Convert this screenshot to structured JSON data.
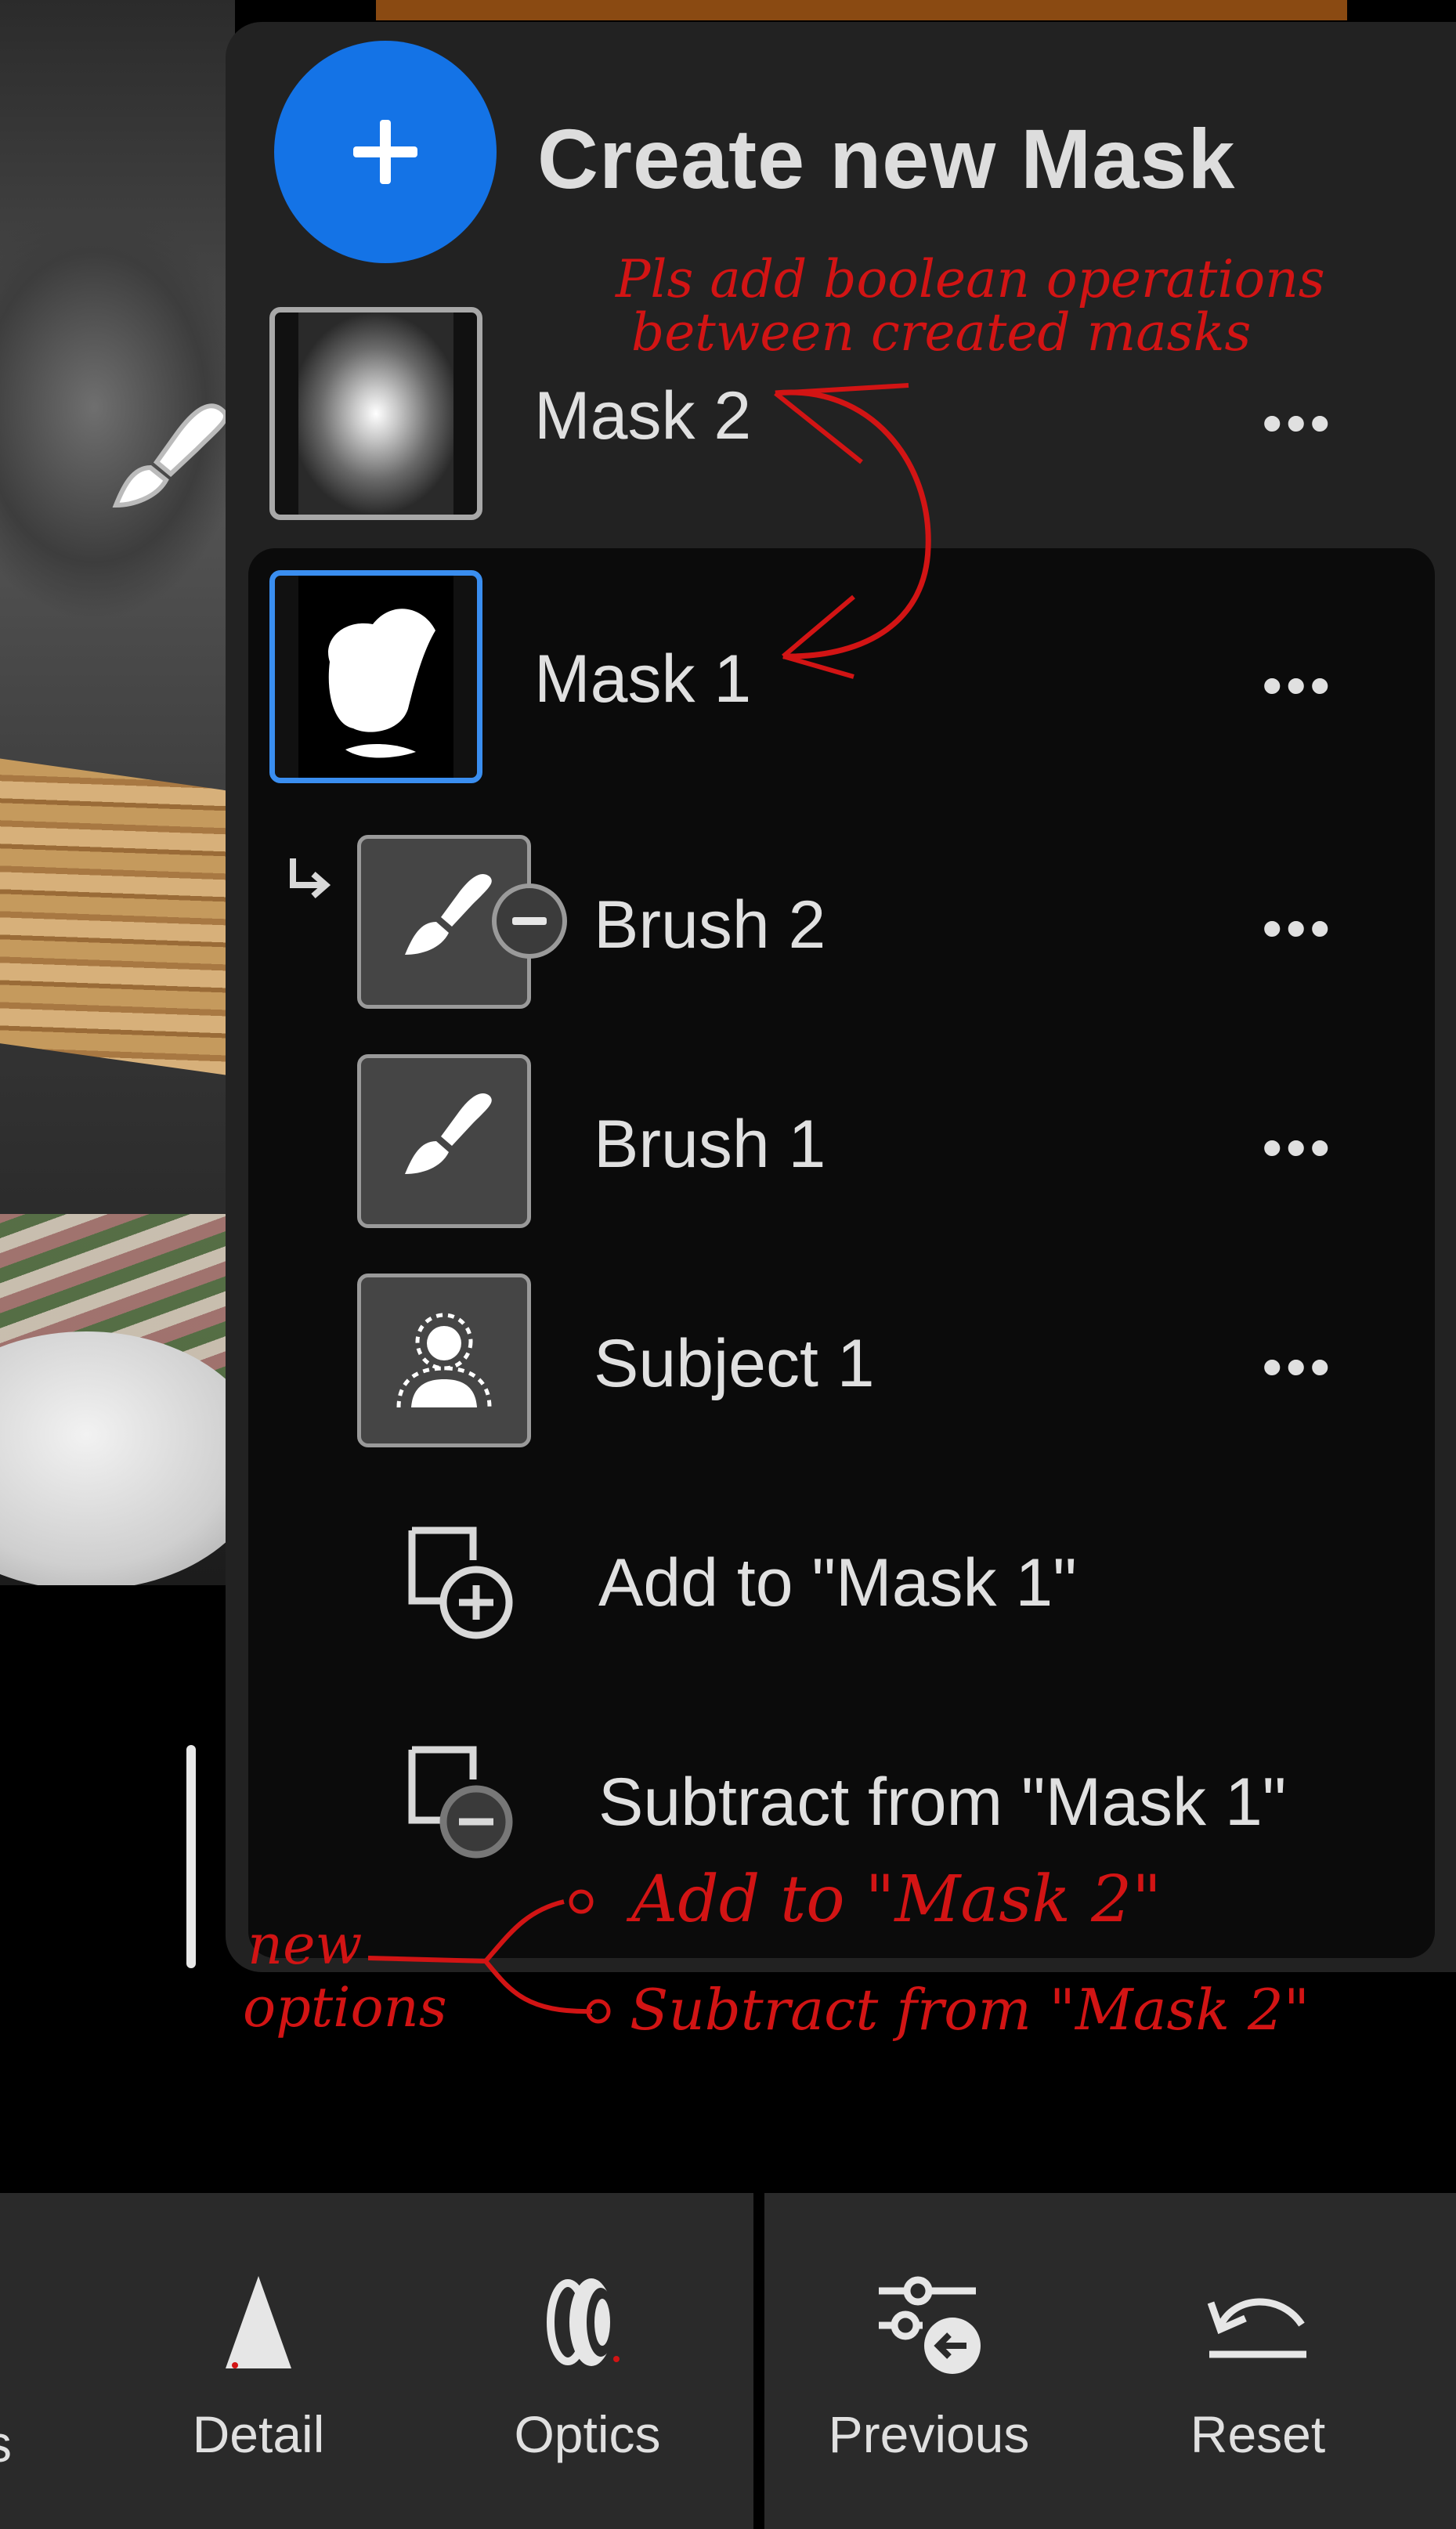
{
  "panel": {
    "create_label": "Create new Mask",
    "masks": [
      {
        "label": "Mask 2",
        "selected": false
      },
      {
        "label": "Mask 1",
        "selected": true
      }
    ],
    "components": [
      {
        "label": "Brush 2",
        "icon": "brush-subtract-icon"
      },
      {
        "label": "Brush 1",
        "icon": "brush-icon"
      },
      {
        "label": "Subject 1",
        "icon": "subject-icon"
      }
    ],
    "actions": [
      {
        "label": "Add to \"Mask 1\"",
        "icon": "add-to-mask-icon"
      },
      {
        "label": "Subtract from \"Mask 1\"",
        "icon": "subtract-from-mask-icon"
      }
    ],
    "more_glyph": "•••"
  },
  "annotations": {
    "request_line1": "Pls add boolean operations",
    "request_line2": "between created masks",
    "new_label_line1": "new",
    "new_label_line2": "options",
    "new_option_1": "Add to \"Mask 2\"",
    "new_option_2": "Subtract from \"Mask 2\""
  },
  "toolbar": {
    "partial_label": "s",
    "items": [
      {
        "label": "Detail",
        "icon": "detail-icon"
      },
      {
        "label": "Optics",
        "icon": "optics-icon"
      },
      {
        "label": "Previous",
        "icon": "previous-icon"
      },
      {
        "label": "Reset",
        "icon": "reset-icon"
      }
    ]
  },
  "colors": {
    "accent": "#1473e6",
    "selected_border": "#3a8ef0",
    "annotation": "#d21414",
    "panel_bg": "#222222",
    "subpanel_bg": "#0b0b0b"
  }
}
